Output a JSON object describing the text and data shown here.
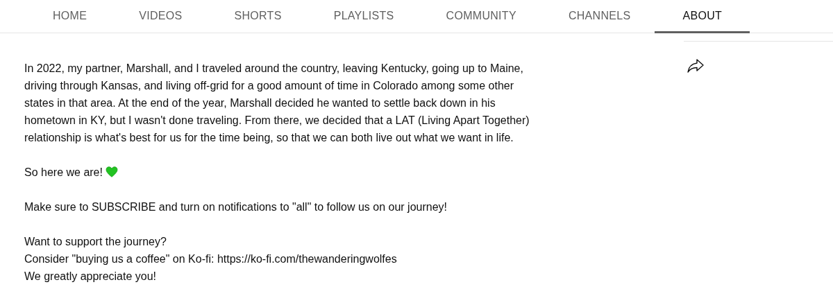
{
  "tabs": [
    {
      "label": "HOME",
      "selected": false
    },
    {
      "label": "VIDEOS",
      "selected": false
    },
    {
      "label": "SHORTS",
      "selected": false
    },
    {
      "label": "PLAYLISTS",
      "selected": false
    },
    {
      "label": "COMMUNITY",
      "selected": false
    },
    {
      "label": "CHANNELS",
      "selected": false
    },
    {
      "label": "ABOUT",
      "selected": true
    }
  ],
  "description": {
    "paragraphs": [
      {
        "lines": [
          "In 2022, my partner, Marshall, and I traveled around the country, leaving Kentucky, going up to Maine,",
          "driving through Kansas, and living off-grid for a good amount of time in Colorado among some other",
          "states in that area. At the end of the year, Marshall decided he wanted to settle back down in his",
          "hometown in KY, but I wasn't done traveling. From there, we decided that a LAT (Living Apart Together)",
          "relationship is what's best for us for the time being, so that we can both live out what we want in life."
        ]
      },
      {
        "lines": [
          "So here we are!"
        ],
        "heart": true
      },
      {
        "lines": [
          "Make sure to SUBSCRIBE and turn on notifications to \"all\" to follow us on our journey!"
        ]
      },
      {
        "lines": [
          "Want to support the journey?",
          "Consider \"buying us a coffee\" on Ko-fi: https://ko-fi.com/thewanderingwolfes",
          "We greatly appreciate you!"
        ]
      }
    ]
  }
}
